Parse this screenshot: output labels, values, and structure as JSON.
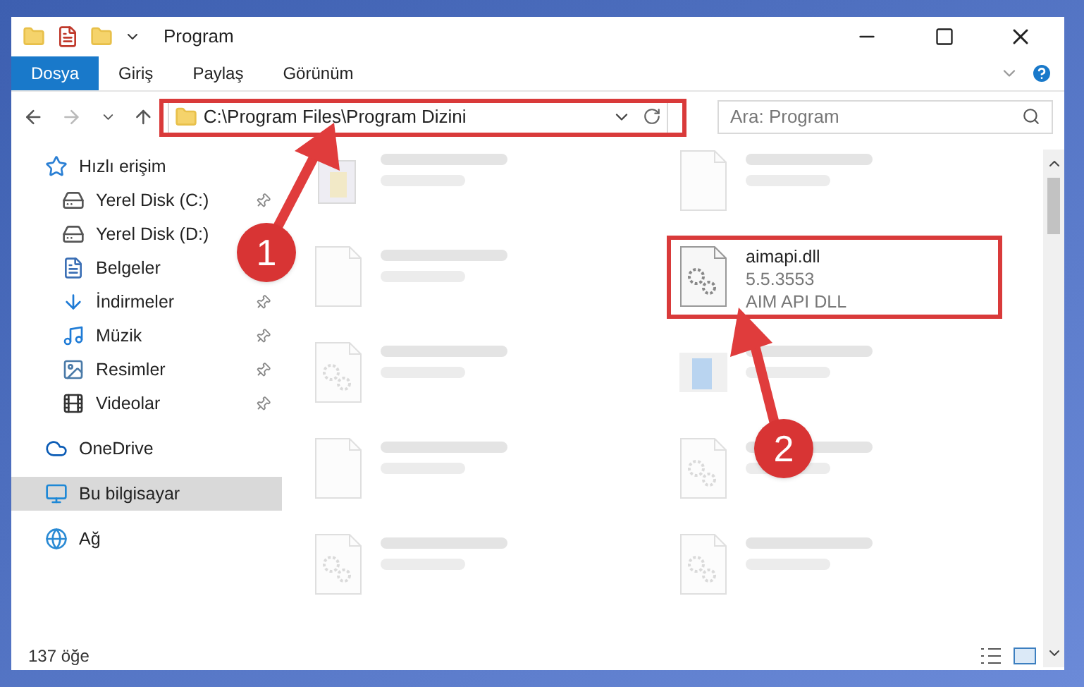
{
  "window": {
    "title": "Program"
  },
  "ribbon_tabs": [
    {
      "label": "Dosya",
      "selected": true
    },
    {
      "label": "Giriş",
      "selected": false
    },
    {
      "label": "Paylaş",
      "selected": false
    },
    {
      "label": "Görünüm",
      "selected": false
    }
  ],
  "address": {
    "path": "C:\\Program Files\\Program Dizini"
  },
  "search": {
    "placeholder": "Ara: Program"
  },
  "sidebar": {
    "items": [
      {
        "label": "Hızlı erişim",
        "selected": false,
        "children": [
          {
            "label": "Yerel Disk (C:)",
            "pinned": true,
            "selected": false
          },
          {
            "label": "Yerel Disk (D:)",
            "pinned": false,
            "selected": false
          },
          {
            "label": "Belgeler",
            "pinned": false,
            "selected": false
          },
          {
            "label": "İndirmeler",
            "pinned": true,
            "selected": false
          },
          {
            "label": "Müzik",
            "pinned": true,
            "selected": false
          },
          {
            "label": "Resimler",
            "pinned": true,
            "selected": false
          },
          {
            "label": "Videolar",
            "pinned": true,
            "selected": false
          }
        ]
      },
      {
        "label": "OneDrive",
        "selected": false
      },
      {
        "label": "Bu bilgisayar",
        "selected": true
      },
      {
        "label": "Ağ",
        "selected": false
      }
    ]
  },
  "files": [
    {
      "kind": "exe",
      "blurred": true
    },
    {
      "kind": "blank",
      "blurred": true
    },
    {
      "kind": "blank",
      "blurred": true
    },
    {
      "kind": "dll",
      "blurred": false,
      "name": "aimapi.dll",
      "lines": [
        "5.5.3553",
        "AIM API DLL"
      ]
    },
    {
      "kind": "dll",
      "blurred": true
    },
    {
      "kind": "app",
      "blurred": true
    },
    {
      "kind": "blank",
      "blurred": true
    },
    {
      "kind": "dll",
      "blurred": true
    },
    {
      "kind": "dll",
      "blurred": true
    },
    {
      "kind": "dll",
      "blurred": true
    }
  ],
  "status_bar": {
    "count": "137 öğe"
  },
  "annotations": [
    {
      "number": "1"
    },
    {
      "number": "2"
    }
  ]
}
